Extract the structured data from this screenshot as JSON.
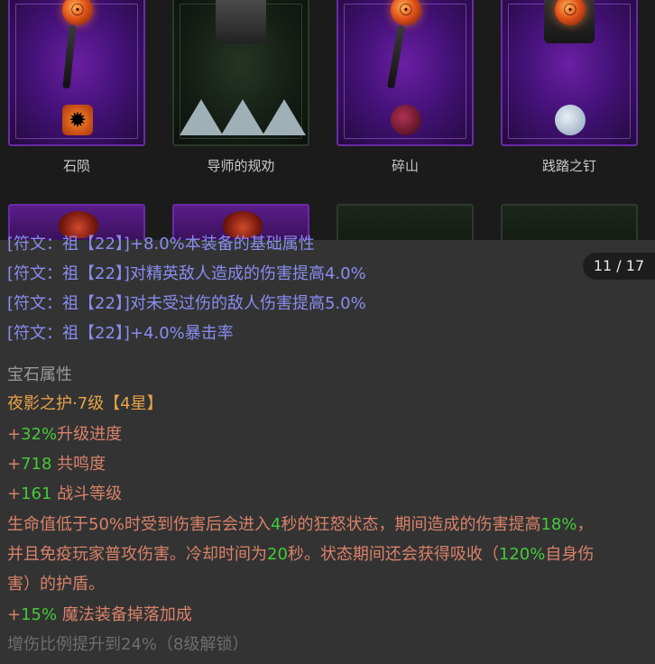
{
  "items": [
    {
      "name": "石陨"
    },
    {
      "name": "导师的规劝"
    },
    {
      "name": "碎山"
    },
    {
      "name": "践踏之钉"
    }
  ],
  "pager": "11 / 17",
  "rune_lines": [
    "[符文：祖【22】]+8.0%本装备的基础属性",
    "[符文：祖【22】]对精英敌人造成的伤害提高4.0%",
    "[符文：祖【22】]对未受过伤的敌人伤害提高5.0%",
    "[符文：祖【22】]+4.0%暴击率"
  ],
  "gem": {
    "section_title": "宝石属性",
    "name": "夜影之护·7级【4星】",
    "stats": [
      {
        "plus": "+",
        "value": "32%",
        "label": "升级进度"
      },
      {
        "plus": "+",
        "value": "718",
        "label": " 共鸣度"
      },
      {
        "plus": "+",
        "value": "161",
        "label": " 战斗等级"
      }
    ],
    "desc": {
      "p1": "生命值低于50%时受到伤害后会进入",
      "v1": "4",
      "p2": "秒的狂怒状态，期间造成的伤害提高",
      "v2": "18%",
      "p3": "，",
      "p4": "并且免疫玩家普攻伤害。冷却时间为",
      "v3": "20",
      "p5": "秒。状态期间还会获得吸收（",
      "v4": "120%",
      "p6": "自身伤",
      "p7": "害）的护盾。"
    },
    "bonus": {
      "plus": "+",
      "value": "15%",
      "label": " 魔法装备掉落加成"
    },
    "locked": "增伤比例提升到24%（8级解锁）"
  }
}
